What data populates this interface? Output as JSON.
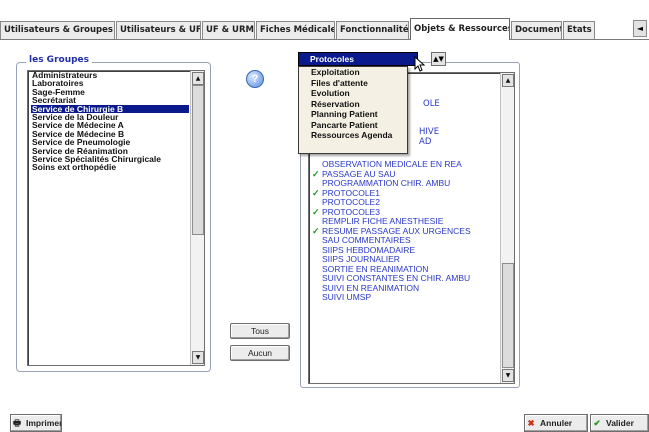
{
  "tabs": [
    {
      "label": "Utilisateurs & Groupes",
      "active": false
    },
    {
      "label": "Utilisateurs & UF",
      "active": false
    },
    {
      "label": "UF & URM",
      "active": false
    },
    {
      "label": "Fiches Médicales",
      "active": false
    },
    {
      "label": "Fonctionnalités",
      "active": false
    },
    {
      "label": "Objets & Ressources",
      "active": true
    },
    {
      "label": "Documents",
      "active": false
    },
    {
      "label": "Etats",
      "active": false
    }
  ],
  "groups": {
    "title": "les Groupes",
    "items": [
      "Administrateurs",
      "Laboratoires",
      "Sage-Femme",
      "Secrétariat",
      "Service de Chirurgie B",
      "Service de la Douleur",
      "Service de Médecine A",
      "Service de Médecine B",
      "Service de Pneumologie",
      "Service de Réanimation",
      "Service Spécialités Chirurgicale",
      "Soins ext orthopédie"
    ],
    "selected_index": 4
  },
  "buttons": {
    "tous": "Tous",
    "aucun": "Aucun",
    "imprimer": "Imprimer",
    "annuler": "Annuler",
    "valider": "Valider"
  },
  "help": "?",
  "resource_type": {
    "selected": "Protocoles",
    "options": [
      "Exploitation",
      "Files d'attente",
      "Evolution",
      "Réservation",
      "Planning Patient",
      "Pancarte Patient",
      "Ressources Agenda"
    ]
  },
  "resources": {
    "partial_visible": [
      "OLE",
      "HIVE",
      "AD"
    ],
    "items": [
      {
        "label": "OBSERVATION MEDICALE EN REA",
        "checked": false
      },
      {
        "label": "PASSAGE AU SAU",
        "checked": true
      },
      {
        "label": "PROGRAMMATION CHIR. AMBU",
        "checked": false
      },
      {
        "label": "PROTOCOLE1",
        "checked": true
      },
      {
        "label": "PROTOCOLE2",
        "checked": false
      },
      {
        "label": "PROTOCOLE3",
        "checked": true
      },
      {
        "label": "REMPLIR FICHE ANESTHESIE",
        "checked": false
      },
      {
        "label": "RESUME PASSAGE AUX URGENCES",
        "checked": true
      },
      {
        "label": "SAU COMMENTAIRES",
        "checked": false
      },
      {
        "label": "SIIPS HEBDOMADAIRE",
        "checked": false
      },
      {
        "label": "SIIPS JOURNALIER",
        "checked": false
      },
      {
        "label": "SORTIE EN REANIMATION",
        "checked": false
      },
      {
        "label": "SUIVI CONSTANTES EN CHIR. AMBU",
        "checked": false
      },
      {
        "label": "SUIVI EN REANIMATION",
        "checked": false
      },
      {
        "label": "SUIVI UMSP",
        "checked": false
      }
    ]
  }
}
